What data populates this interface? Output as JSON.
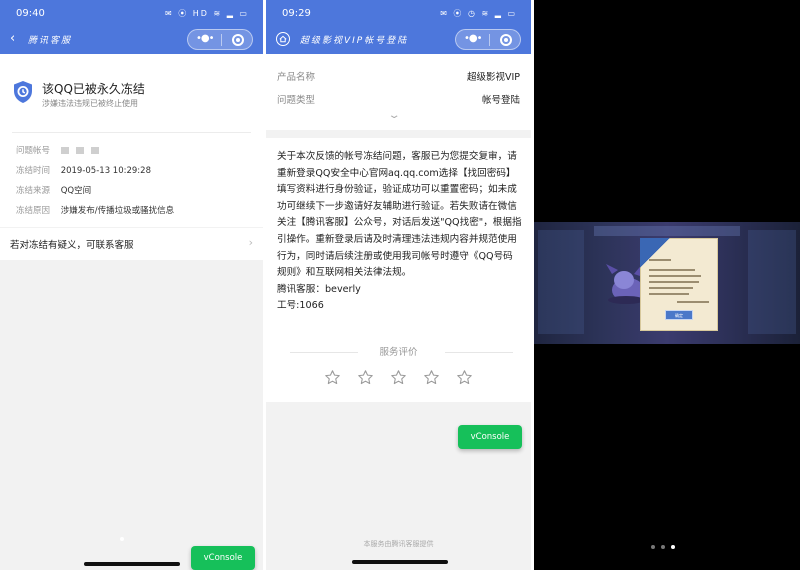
{
  "panel1": {
    "status_time": "09:40",
    "status_icons": "✉ ⦿ HD ≋ ▂ ▭",
    "title": "腾讯客服",
    "heading": "该QQ已被永久冻结",
    "subheading": "涉嫌违法违规已被终止使用",
    "info": [
      {
        "label": "问题帐号",
        "value": ""
      },
      {
        "label": "冻结时间",
        "value": "2019-05-13 10:29:28"
      },
      {
        "label": "冻结来源",
        "value": "QQ空间"
      },
      {
        "label": "冻结原因",
        "value": "涉嫌发布/传播垃圾或骚扰信息"
      }
    ],
    "contact_text": "若对冻结有疑义，可联系客服",
    "vconsole_label": "vConsole"
  },
  "panel2": {
    "status_time": "09:29",
    "status_icons": "✉ ⦿ ◷ ≋ ▂ ▭",
    "title": "超级影视VIP帐号登陆",
    "rows": [
      {
        "key": "产品名称",
        "value": "超级影视VIP"
      },
      {
        "key": "问题类型",
        "value": "帐号登陆"
      }
    ],
    "body_paragraphs": [
      "关于本次反馈的帐号冻结问题，客服已为您提交复审，请重新登录QQ安全中心官网aq.qq.com选择【找回密码】填写资料进行身份验证，验证成功可以重置密码；如未成功可继续下一步邀请好友辅助进行验证。若失败请在微信关注【腾讯客服】公众号，对话后发送\"QQ找密\"，根据指引操作。重新登录后请及时清理违法违规内容并规范使用行为，同时请后续注册或使用我司帐号时遵守《QQ号码规则》和互联网相关法律法规。",
      "腾讯客服：beverly",
      "工号:1066"
    ],
    "rating_title": "服务评价",
    "stars": 5,
    "vconsole_label": "vConsole",
    "footer_note": "本服务由腾讯客服提供"
  },
  "panel3": {
    "dialog_button": "确定"
  },
  "colors": {
    "header_blue": "#4d77dc",
    "vconsole_green": "#16c05a",
    "star_outline": "#999999"
  }
}
